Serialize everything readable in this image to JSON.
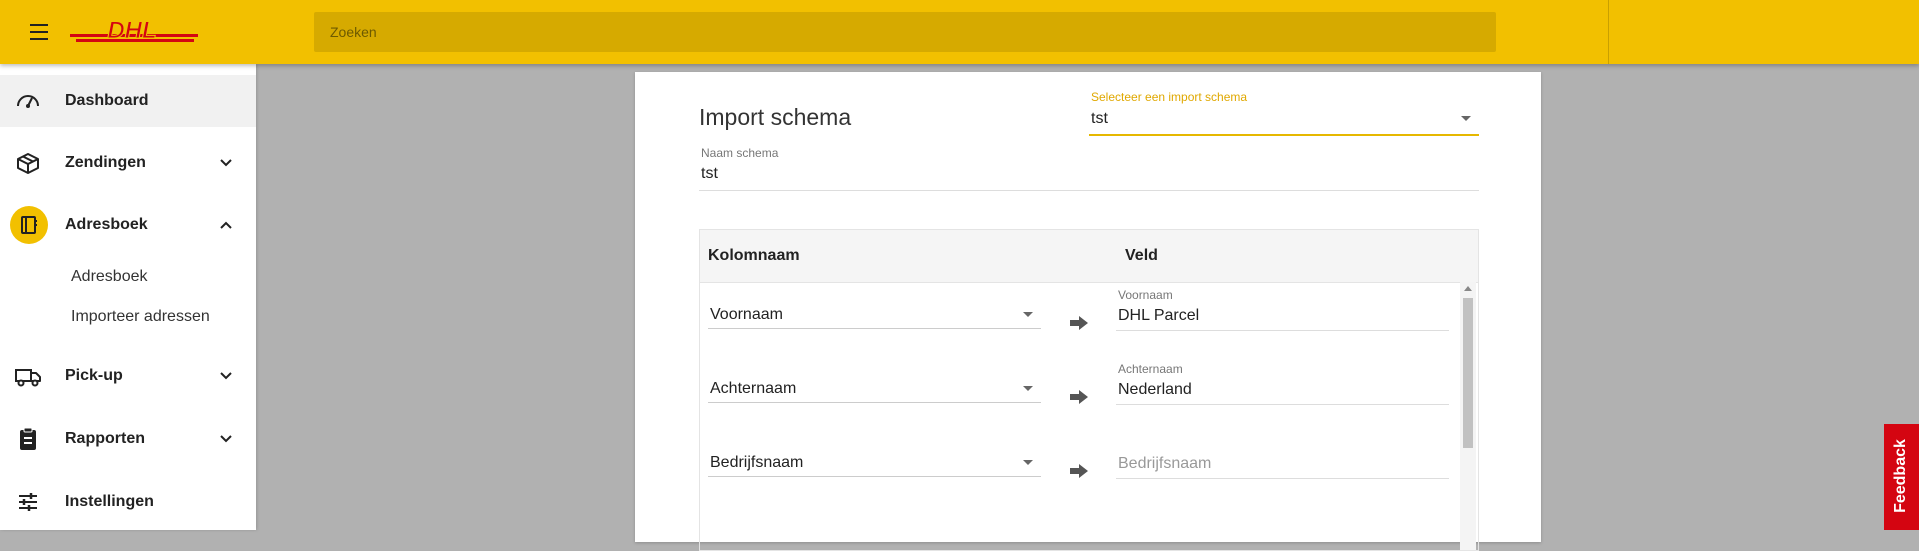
{
  "header": {
    "brand": "DHL",
    "search_placeholder": "Zoeken"
  },
  "colors": {
    "brand_yellow": "#f2c000",
    "brand_red": "#d40511"
  },
  "sidebar": {
    "items": [
      {
        "label": "Dashboard",
        "icon": "speedometer-icon"
      },
      {
        "label": "Zendingen",
        "icon": "package-icon",
        "expanded": false
      },
      {
        "label": "Adresboek",
        "icon": "address-book-icon",
        "expanded": true
      },
      {
        "label": "Pick-up",
        "icon": "truck-icon",
        "expanded": false
      },
      {
        "label": "Rapporten",
        "icon": "clipboard-icon",
        "expanded": false
      },
      {
        "label": "Instellingen",
        "icon": "sliders-icon"
      }
    ],
    "subitems": [
      "Adresboek",
      "Importeer adressen"
    ]
  },
  "form": {
    "title": "Import schema",
    "select_label": "Selecteer een import schema",
    "select_value": "tst",
    "name_label": "Naam schema",
    "name_value": "tst"
  },
  "table": {
    "headers": [
      "Kolomnaam",
      "Veld"
    ],
    "rows": [
      {
        "column": "Voornaam",
        "field_label": "Voornaam",
        "field_value": "DHL Parcel",
        "placeholder": ""
      },
      {
        "column": "Achternaam",
        "field_label": "Achternaam",
        "field_value": "Nederland",
        "placeholder": ""
      },
      {
        "column": "Bedrijfsnaam",
        "field_label": "",
        "field_value": "",
        "placeholder": "Bedrijfsnaam"
      }
    ]
  },
  "feedback_label": "Feedback"
}
